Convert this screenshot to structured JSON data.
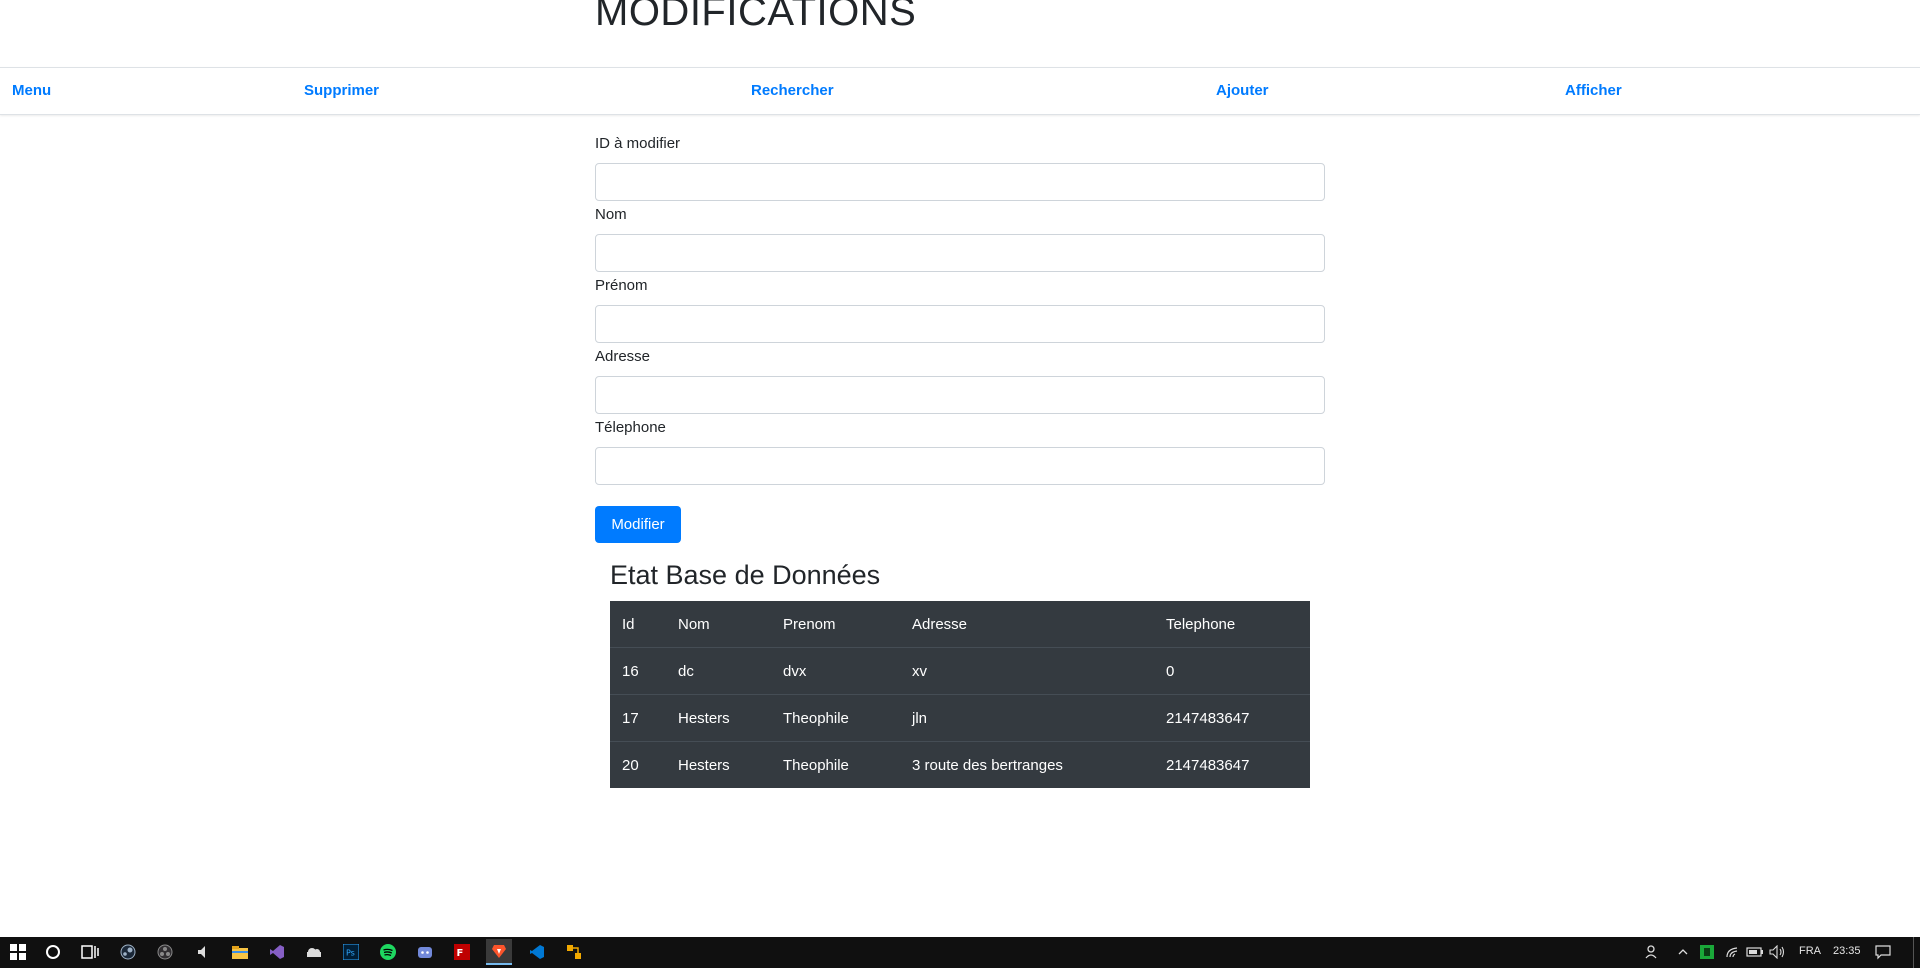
{
  "page": {
    "title": "MODIFICATIONS"
  },
  "nav": {
    "menu": "Menu",
    "supprimer": "Supprimer",
    "rechercher": "Rechercher",
    "ajouter": "Ajouter",
    "afficher": "Afficher"
  },
  "form": {
    "id_label": "ID à modifier",
    "nom_label": "Nom",
    "prenom_label": "Prénom",
    "adresse_label": "Adresse",
    "telephone_label": "Télephone",
    "submit_label": "Modifier"
  },
  "db": {
    "title": "Etat Base de Données",
    "headers": [
      "Id",
      "Nom",
      "Prenom",
      "Adresse",
      "Telephone"
    ],
    "rows": [
      [
        "16",
        "dc",
        "dvx",
        "xv",
        "0"
      ],
      [
        "17",
        "Hesters",
        "Theophile",
        "jln",
        "2147483647"
      ],
      [
        "20",
        "Hesters",
        "Theophile",
        "3 route des bertranges",
        "2147483647"
      ]
    ]
  },
  "taskbar": {
    "language": "FRA",
    "time": "23:35",
    "accent_color": "#76b9ed",
    "icons": [
      "windows-start-icon",
      "cortana-icon",
      "task-view-icon",
      "steam-icon",
      "obs-icon",
      "audio-icon",
      "file-explorer-icon",
      "visual-studio-icon",
      "cloud-icon",
      "photoshop-icon",
      "spotify-icon",
      "discord-icon",
      "filezilla-icon",
      "brave-icon",
      "vscode-icon",
      "app-icon"
    ]
  },
  "colors": {
    "link": "#007bff",
    "button": "#007bff",
    "table_bg": "#343a40"
  }
}
